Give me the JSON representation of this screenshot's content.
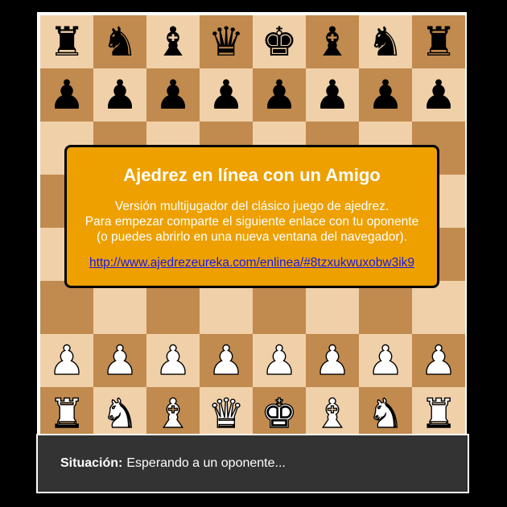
{
  "board": {
    "colors": {
      "light": "#f0d0a8",
      "dark": "#c18a4e"
    },
    "rows": [
      [
        "b-rook",
        "b-knight",
        "b-bishop",
        "b-queen",
        "b-king",
        "b-bishop",
        "b-knight",
        "b-rook"
      ],
      [
        "b-pawn",
        "b-pawn",
        "b-pawn",
        "b-pawn",
        "b-pawn",
        "b-pawn",
        "b-pawn",
        "b-pawn"
      ],
      [
        "",
        "",
        "",
        "",
        "",
        "",
        "",
        ""
      ],
      [
        "",
        "",
        "",
        "",
        "",
        "",
        "",
        ""
      ],
      [
        "",
        "",
        "",
        "",
        "",
        "",
        "",
        ""
      ],
      [
        "",
        "",
        "",
        "",
        "",
        "",
        "",
        ""
      ],
      [
        "w-pawn",
        "w-pawn",
        "w-pawn",
        "w-pawn",
        "w-pawn",
        "w-pawn",
        "w-pawn",
        "w-pawn"
      ],
      [
        "w-rook",
        "w-knight",
        "w-bishop",
        "w-queen",
        "w-king",
        "w-bishop",
        "w-knight",
        "w-rook"
      ]
    ]
  },
  "dialog": {
    "title": "Ajedrez en línea con un Amigo",
    "line1": "Versión multijugador del clásico juego de ajedrez.",
    "line2": "Para empezar comparte el siguiente enlace con tu oponente",
    "line3": "(o puedes abrirlo en una nueva ventana del navegador).",
    "link": "http://www.ajedrezeureka.com/enlinea/#8tzxukwuxobw3ik9",
    "background": "#eda000"
  },
  "status": {
    "label": "Situación:",
    "text": "Esperando a un oponente..."
  }
}
